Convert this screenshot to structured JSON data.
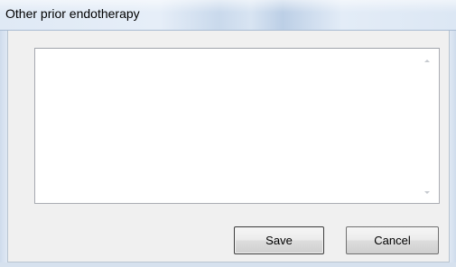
{
  "window": {
    "title": "Other prior endotherapy"
  },
  "textarea": {
    "value": "",
    "placeholder": ""
  },
  "buttons": {
    "save_label": "Save",
    "cancel_label": "Cancel"
  },
  "icons": {
    "scroll_up": "scroll-up-arrow-icon",
    "scroll_down": "scroll-down-arrow-icon"
  }
}
